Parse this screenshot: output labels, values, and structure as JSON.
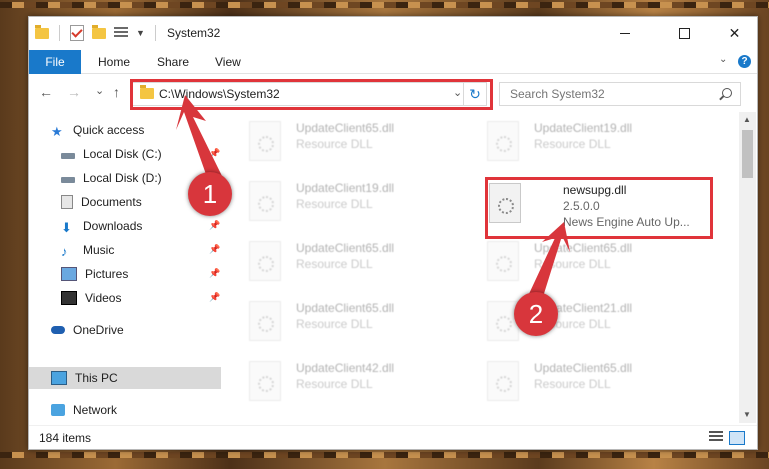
{
  "window": {
    "title": "System32"
  },
  "controls": {
    "minimize": "—",
    "maximize": "☐",
    "close": "✕"
  },
  "ribbon": {
    "file": "File",
    "home": "Home",
    "share": "Share",
    "view": "View",
    "help": "?"
  },
  "address": {
    "path": "C:\\Windows\\System32",
    "caret": "⌄",
    "refresh": "↻"
  },
  "search": {
    "placeholder": "Search System32"
  },
  "nav": {
    "back": "←",
    "forward": "→",
    "recent": "⌄",
    "up": "↑"
  },
  "sidebar": {
    "items": [
      {
        "label": "Quick access",
        "icon": "star-icon"
      },
      {
        "label": "Local Disk (C:)",
        "icon": "disk-icon"
      },
      {
        "label": "Local Disk (D:)",
        "icon": "disk-icon"
      },
      {
        "label": "Documents",
        "icon": "documents-icon"
      },
      {
        "label": "Downloads",
        "icon": "download-icon"
      },
      {
        "label": "Music",
        "icon": "music-icon"
      },
      {
        "label": "Pictures",
        "icon": "pictures-icon"
      },
      {
        "label": "Videos",
        "icon": "videos-icon"
      },
      {
        "label": "OneDrive",
        "icon": "cloud-icon"
      },
      {
        "label": "This PC",
        "icon": "computer-icon"
      },
      {
        "label": "Network",
        "icon": "network-icon"
      }
    ]
  },
  "files": [
    {
      "name": "UpdateClient65.dll",
      "desc": "Resource DLL"
    },
    {
      "name": "UpdateClient19.dll",
      "desc": "Resource DLL"
    },
    {
      "name": "UpdateClient19.dll",
      "desc": "Resource DLL"
    },
    {
      "name": "newsupg.dll",
      "version": "2.5.0.0",
      "desc": "News Engine Auto Up..."
    },
    {
      "name": "UpdateClient65.dll",
      "desc": "Resource DLL"
    },
    {
      "name": "UpdateClient65.dll",
      "desc": "Resource DLL"
    },
    {
      "name": "UpdateClient65.dll",
      "desc": "Resource DLL"
    },
    {
      "name": "UpdateClient21.dll",
      "desc": "Resource DLL"
    },
    {
      "name": "UpdateClient42.dll",
      "desc": "Resource DLL"
    },
    {
      "name": "UpdateClient65.dll",
      "desc": "Resource DLL"
    }
  ],
  "status": {
    "count": "184 items"
  },
  "annotations": {
    "marker1": "1",
    "marker2": "2",
    "color": "#e0343a"
  }
}
